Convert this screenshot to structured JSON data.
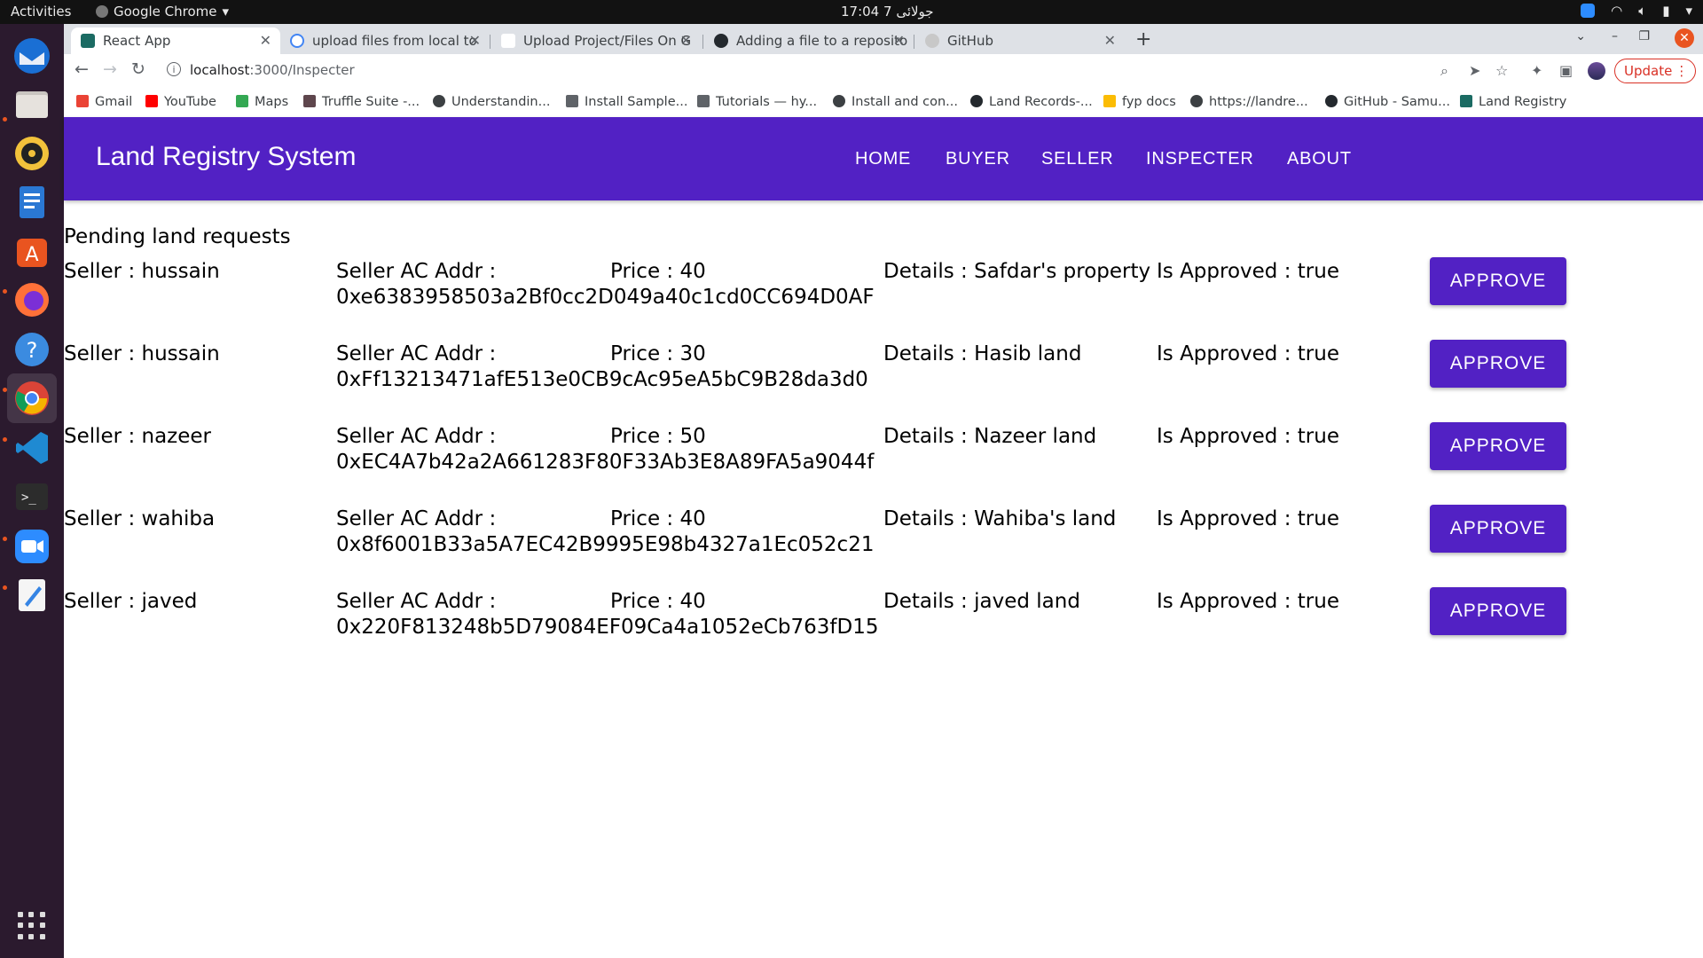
{
  "system": {
    "activities": "Activities",
    "app_name": "Google Chrome",
    "clock": "17:04  7 جولائی"
  },
  "tabs": [
    {
      "label": "React App",
      "icon": "react-icon",
      "active": true
    },
    {
      "label": "upload files from local to",
      "icon": "google-icon"
    },
    {
      "label": "Upload Project/Files On G",
      "icon": "youtube-icon"
    },
    {
      "label": "Adding a file to a reposito",
      "icon": "github-icon"
    },
    {
      "label": "GitHub",
      "icon": "github-icon"
    }
  ],
  "toolbar": {
    "url_host": "localhost",
    "url_path": ":3000/Inspecter",
    "update_label": "Update"
  },
  "bookmarks": [
    {
      "label": "Gmail",
      "icon": "gmail-icon"
    },
    {
      "label": "YouTube",
      "icon": "youtube-icon"
    },
    {
      "label": "Maps",
      "icon": "maps-icon"
    },
    {
      "label": "Truffle Suite -...",
      "icon": "truffle-icon"
    },
    {
      "label": "Understandin...",
      "icon": "web-icon"
    },
    {
      "label": "Install Sample...",
      "icon": "doc-icon"
    },
    {
      "label": "Tutorials — hy...",
      "icon": "doc-icon"
    },
    {
      "label": "Install and con...",
      "icon": "web-icon"
    },
    {
      "label": "Land Records-...",
      "icon": "github-icon"
    },
    {
      "label": "fyp docs",
      "icon": "drive-icon"
    },
    {
      "label": "https://landre...",
      "icon": "web-icon"
    },
    {
      "label": "GitHub - Samu...",
      "icon": "github-icon"
    },
    {
      "label": "Land Registry",
      "icon": "react-icon"
    }
  ],
  "app": {
    "brand": "Land Registry System",
    "nav": [
      "HOME",
      "BUYER",
      "SELLER",
      "INSPECTER",
      "ABOUT"
    ],
    "heading": "Pending land requests",
    "approve_label": "APPROVE",
    "requests": [
      {
        "seller": "Seller : hussain",
        "addr_label": "Seller AC Addr :",
        "addr": "0xe6383958503a2Bf0cc2D049a40c1cd0CC694D0AF",
        "price": "Price : 40",
        "details": "Details : Safdar's property",
        "approved": "Is Approved : true"
      },
      {
        "seller": "Seller : hussain",
        "addr_label": "Seller AC Addr :",
        "addr": "0xFf13213471afE513e0CB9cAc95eA5bC9B28da3d0",
        "price": "Price : 30",
        "details": "Details : Hasib land",
        "approved": "Is Approved : true"
      },
      {
        "seller": "Seller : nazeer",
        "addr_label": "Seller AC Addr :",
        "addr": "0xEC4A7b42a2A661283F80F33Ab3E8A89FA5a9044f",
        "price": "Price : 50",
        "details": "Details : Nazeer land",
        "approved": "Is Approved : true"
      },
      {
        "seller": "Seller : wahiba",
        "addr_label": "Seller AC Addr :",
        "addr": "0x8f6001B33a5A7EC42B9995E98b4327a1Ec052c21",
        "price": "Price : 40",
        "details": "Details : Wahiba's land",
        "approved": "Is Approved : true"
      },
      {
        "seller": "Seller : javed",
        "addr_label": "Seller AC Addr :",
        "addr": "0x220F813248b5D79084EF09Ca4a1052eCb763fD15",
        "price": "Price : 40",
        "details": "Details : javed land",
        "approved": "Is Approved : true"
      }
    ]
  },
  "colors": {
    "appbar": "#5221c4",
    "dock": "#2b1a2e",
    "update": "#d93025",
    "close": "#e95420"
  },
  "dock_icons": [
    "thunderbird-icon",
    "files-icon",
    "rhythmbox-icon",
    "writer-icon",
    "software-icon",
    "firefox-icon",
    "help-icon",
    "chrome-icon",
    "vscode-icon",
    "terminal-icon",
    "zoom-icon",
    "text-editor-icon"
  ]
}
